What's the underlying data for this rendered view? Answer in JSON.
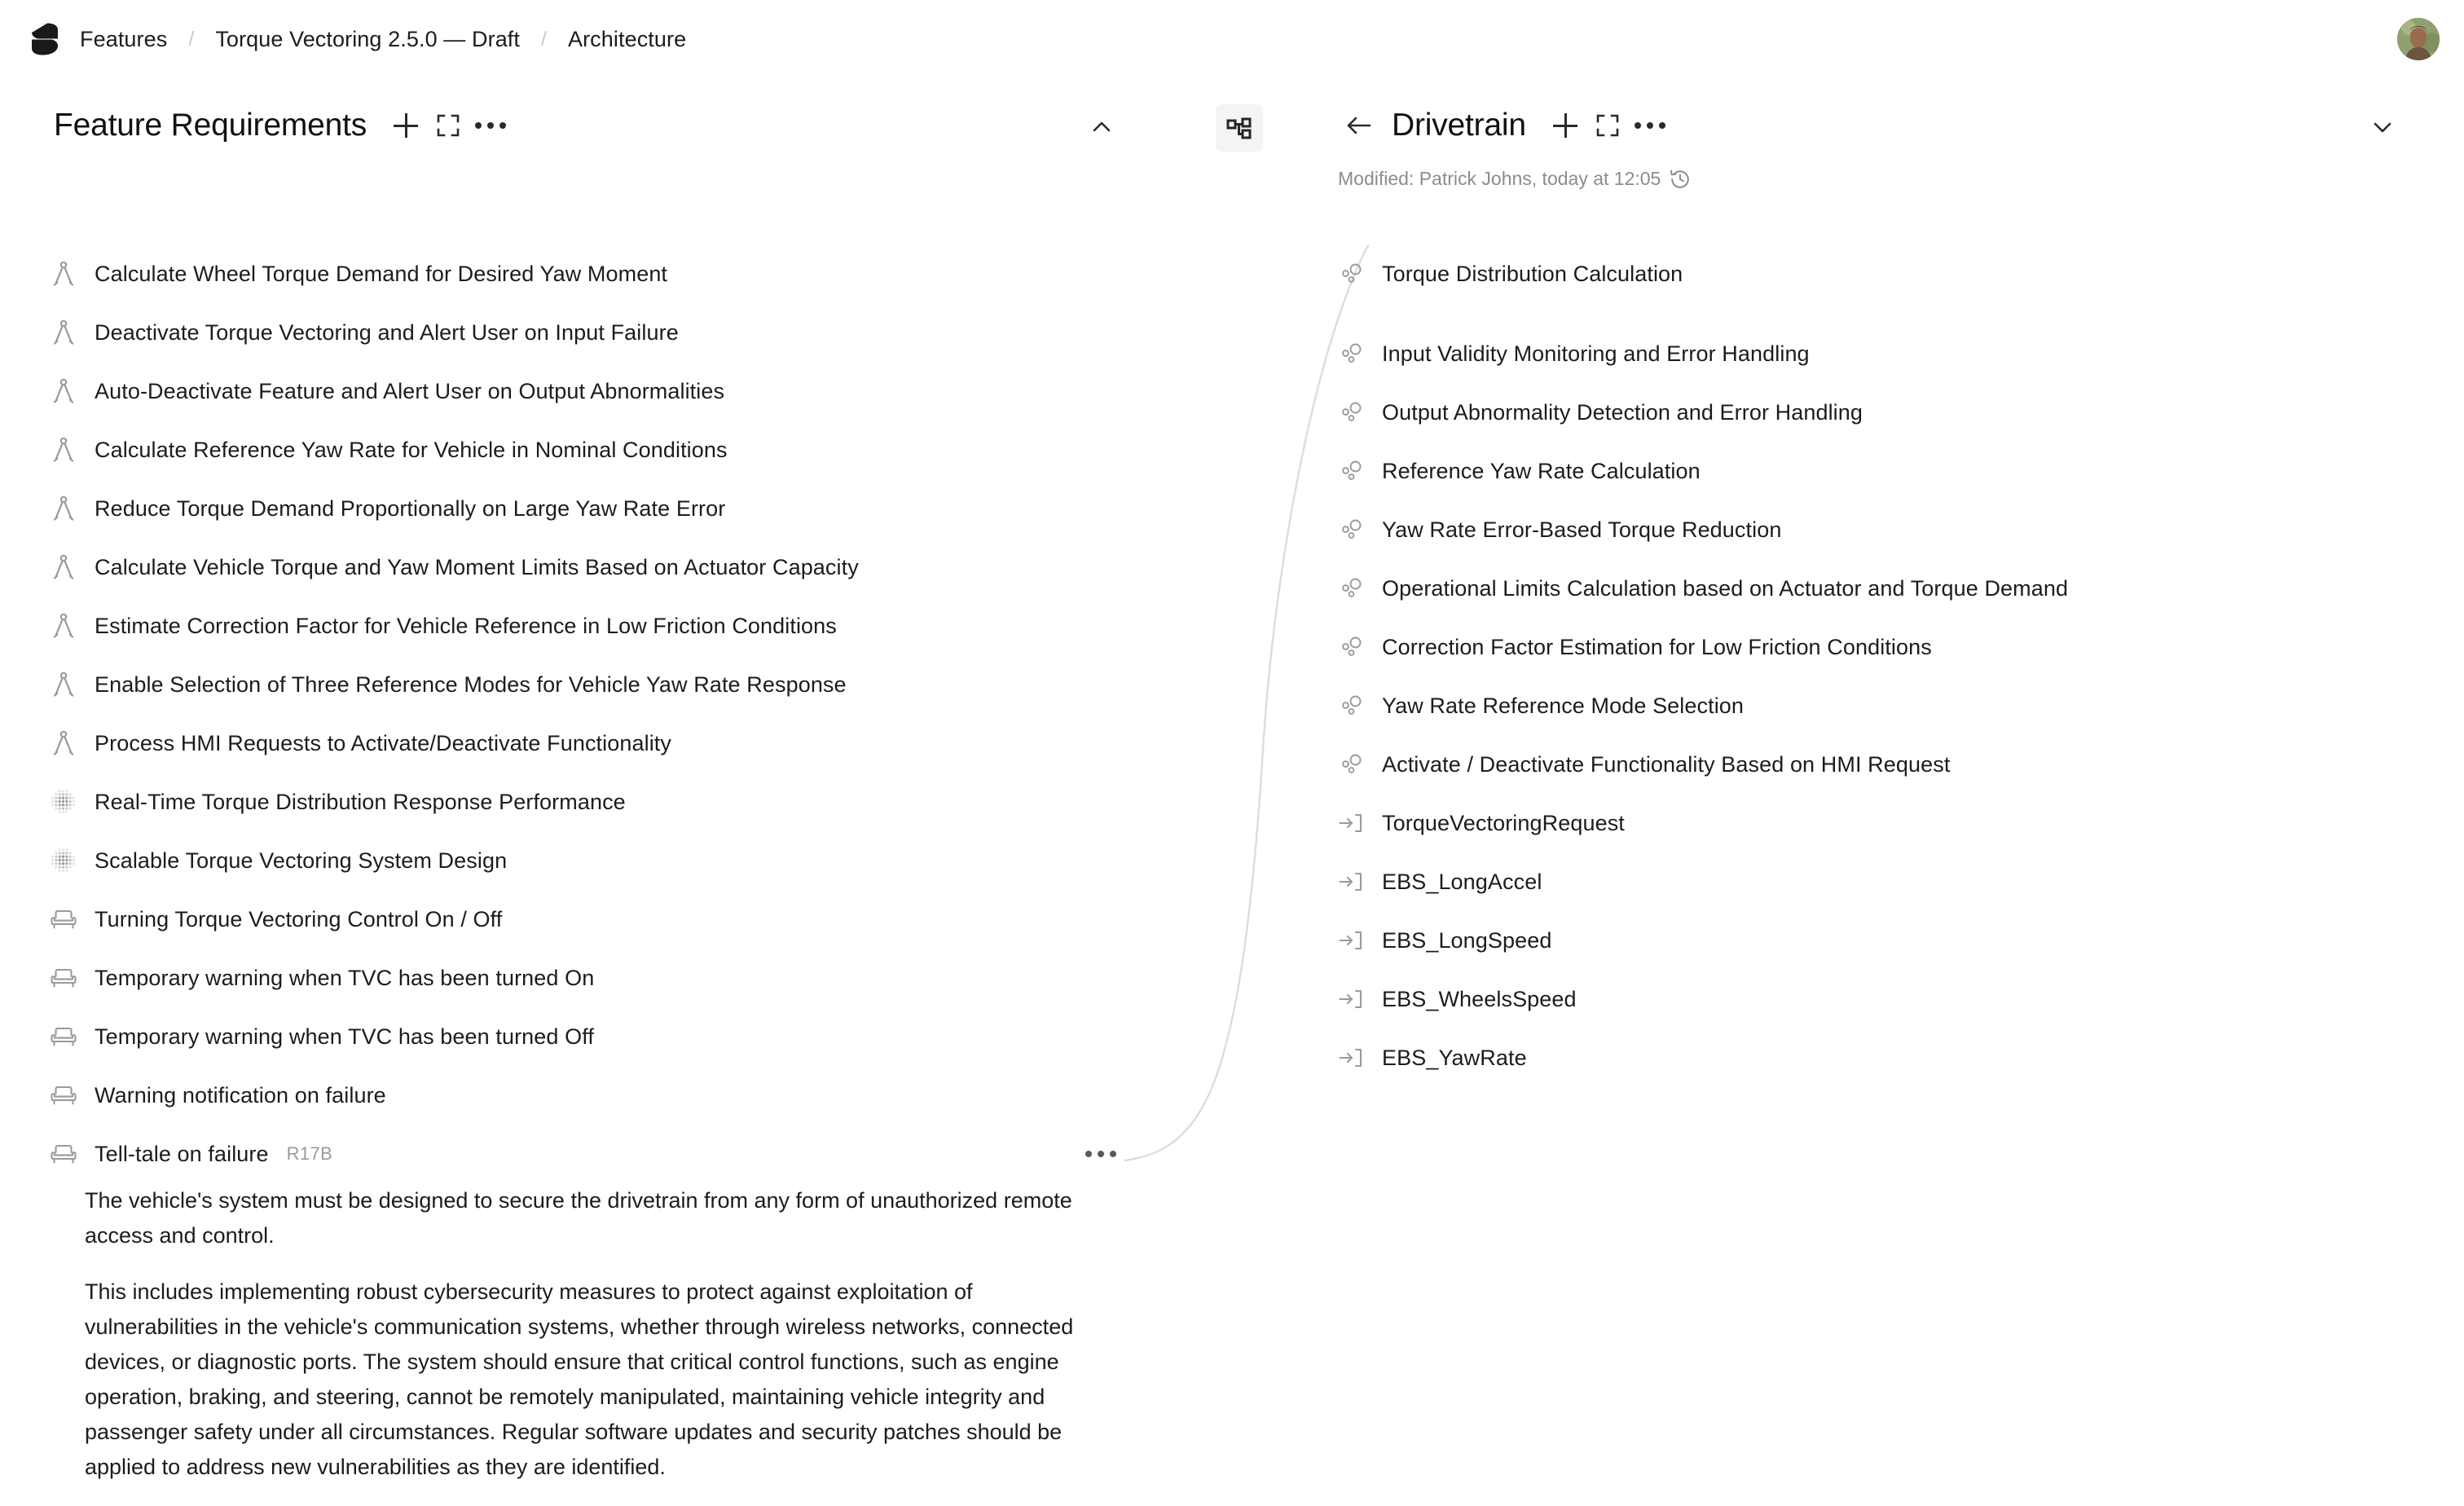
{
  "topbar": {
    "logo_name": "codebeamer-logo",
    "breadcrumbs": [
      {
        "label": "Features"
      },
      {
        "label": "Torque Vectoring 2.5.0 — Draft"
      },
      {
        "label": "Architecture"
      }
    ],
    "separator": "/",
    "avatar_name": "user-avatar"
  },
  "left_panel": {
    "title": "Feature Requirements",
    "actions": [
      {
        "name": "add-item-button",
        "icon": "plus-icon"
      },
      {
        "name": "expand-panel-button",
        "icon": "fullscreen-icon"
      },
      {
        "name": "more-options-button",
        "icon": "ellipsis-icon"
      }
    ],
    "collapse_icon": "chevron-up-icon",
    "items": [
      {
        "icon": "compass-icon",
        "label": "Calculate Wheel Torque Demand for Desired Yaw Moment"
      },
      {
        "icon": "compass-icon",
        "label": "Deactivate Torque Vectoring and Alert User on Input Failure"
      },
      {
        "icon": "compass-icon",
        "label": "Auto-Deactivate Feature and Alert User on Output Abnormalities"
      },
      {
        "icon": "compass-icon",
        "label": "Calculate Reference Yaw Rate for Vehicle in Nominal Conditions"
      },
      {
        "icon": "compass-icon",
        "label": "Reduce Torque Demand Proportionally on Large Yaw Rate Error"
      },
      {
        "icon": "compass-icon",
        "label": "Calculate Vehicle Torque and Yaw Moment Limits Based on Actuator Capacity"
      },
      {
        "icon": "compass-icon",
        "label": "Estimate Correction Factor for Vehicle Reference in Low Friction Conditions"
      },
      {
        "icon": "compass-icon",
        "label": "Enable Selection of Three Reference Modes for Vehicle Yaw Rate Response"
      },
      {
        "icon": "compass-icon",
        "label": "Process HMI Requests to Activate/Deactivate Functionality"
      },
      {
        "icon": "dot-grid-icon",
        "label": "Real-Time Torque Distribution Response Performance"
      },
      {
        "icon": "dot-grid-icon",
        "label": "Scalable Torque Vectoring System Design"
      },
      {
        "icon": "armchair-icon",
        "label": "Turning Torque Vectoring Control On / Off"
      },
      {
        "icon": "armchair-icon",
        "label": "Temporary warning when TVC has been turned On"
      },
      {
        "icon": "armchair-icon",
        "label": "Temporary warning when TVC has been turned Off"
      },
      {
        "icon": "armchair-icon",
        "label": "Warning notification on failure"
      },
      {
        "icon": "armchair-icon",
        "label": "Tell-tale on failure",
        "badge": "R17B",
        "has_dots": true
      }
    ]
  },
  "detail": {
    "paragraphs": [
      "The vehicle's system must be designed to secure the drivetrain from any form of unauthorized remote access and control.",
      "This includes implementing robust cybersecurity measures to protect against exploitation of vulnerabilities in the vehicle's communication systems, whether through wireless networks, connected devices, or diagnostic ports. The system should ensure that critical control functions, such as engine operation, braking, and steering, cannot be remotely manipulated, maintaining vehicle integrity and passenger safety under all circumstances. Regular software updates and security patches should be applied to address new vulnerabilities as they are identified."
    ]
  },
  "tree_toggle": {
    "name": "hierarchy-view-toggle",
    "icon": "hierarchy-icon",
    "active": true
  },
  "right_panel": {
    "back_icon": "arrow-left-icon",
    "title": "Drivetrain",
    "actions": [
      {
        "name": "add-item-button",
        "icon": "plus-icon"
      },
      {
        "name": "expand-panel-button",
        "icon": "fullscreen-icon"
      },
      {
        "name": "more-options-button",
        "icon": "ellipsis-icon"
      }
    ],
    "collapse_icon": "chevron-down-icon",
    "modified_text": "Modified: Patrick Johns, today at 12:05",
    "history_icon": "history-clock-icon",
    "items": [
      {
        "icon": "molecule-icon",
        "label": "Torque Distribution Calculation",
        "spaced": true
      },
      {
        "icon": "molecule-icon",
        "label": "Input Validity Monitoring and Error Handling"
      },
      {
        "icon": "molecule-icon",
        "label": "Output Abnormality Detection and Error Handling"
      },
      {
        "icon": "molecule-icon",
        "label": "Reference Yaw Rate Calculation"
      },
      {
        "icon": "molecule-icon",
        "label": "Yaw Rate Error-Based Torque Reduction"
      },
      {
        "icon": "molecule-icon",
        "label": "Operational Limits Calculation based on Actuator and Torque Demand"
      },
      {
        "icon": "molecule-icon",
        "label": "Correction Factor Estimation for Low Friction Conditions"
      },
      {
        "icon": "molecule-icon",
        "label": "Yaw Rate Reference Mode Selection"
      },
      {
        "icon": "molecule-icon",
        "label": "Activate / Deactivate Functionality Based on HMI Request"
      },
      {
        "icon": "input-arrow-icon",
        "label": "TorqueVectoringRequest"
      },
      {
        "icon": "input-arrow-icon",
        "label": "EBS_LongAccel"
      },
      {
        "icon": "input-arrow-icon",
        "label": "EBS_LongSpeed"
      },
      {
        "icon": "input-arrow-icon",
        "label": "EBS_WheelsSpeed"
      },
      {
        "icon": "input-arrow-icon",
        "label": "EBS_YawRate"
      }
    ]
  },
  "colors": {
    "text": "#1c1c1c",
    "muted": "#8c8c8c",
    "icon_gray": "#9a9a9a",
    "connector": "#dcdcdc",
    "toggle_bg": "#f4f4f4"
  }
}
